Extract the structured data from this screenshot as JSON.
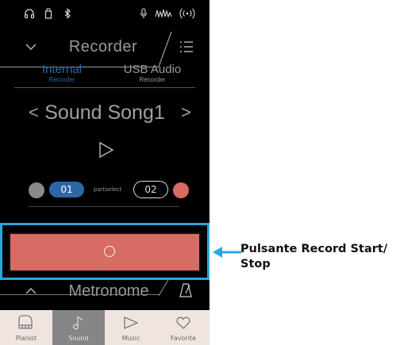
{
  "status_bar": {
    "icons": [
      "headphones-icon",
      "usb-drive-icon",
      "bluetooth-icon",
      "microphone-icon",
      "resonance-icon",
      "wireless-icon"
    ]
  },
  "header": {
    "title": "Recorder"
  },
  "recorder_tabs": [
    {
      "label": "Internal",
      "sublabel": "Recorder",
      "active": true
    },
    {
      "label": "USB Audio",
      "sublabel": "Recorder",
      "active": false
    }
  ],
  "song": {
    "prev_glyph": "<",
    "name": "Sound Song1",
    "next_glyph": ">"
  },
  "parts": {
    "part1_label": "01",
    "select_label": "partselect",
    "part2_label": "02"
  },
  "record_button": {
    "icon": "record-circle-icon"
  },
  "metronome": {
    "label": "Metronome"
  },
  "bottom_tabs": [
    {
      "label": "Pianist",
      "icon": "piano-icon",
      "active": false
    },
    {
      "label": "Sound",
      "icon": "music-note-icon",
      "active": true
    },
    {
      "label": "Music",
      "icon": "play-icon",
      "active": false
    },
    {
      "label": "Favorite",
      "icon": "heart-icon",
      "active": false
    }
  ],
  "callout": {
    "line1": "Pulsante Record Start/",
    "line2": "Stop"
  },
  "colors": {
    "accent_blue": "#2d67a8",
    "record_red": "#d66c64",
    "highlight_cyan": "#2aa7dd",
    "tabbar_bg": "#efe4df"
  }
}
